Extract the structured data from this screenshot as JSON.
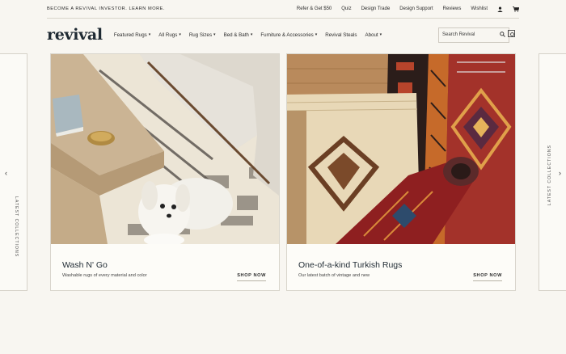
{
  "topbar": {
    "promo": "BECOME A REVIVAL INVESTOR. LEARN MORE.",
    "links": [
      "Refer & Get $50",
      "Quiz",
      "Design Trade",
      "Design Support",
      "Reviews",
      "Wishlist"
    ],
    "icons": [
      "user-icon",
      "cart-icon"
    ]
  },
  "nav": {
    "logo": "revival",
    "menu": [
      {
        "label": "Featured Rugs",
        "has_dropdown": true
      },
      {
        "label": "All Rugs",
        "has_dropdown": true
      },
      {
        "label": "Rug Sizes",
        "has_dropdown": true
      },
      {
        "label": "Bed & Bath",
        "has_dropdown": true
      },
      {
        "label": "Furniture & Accessories",
        "has_dropdown": true
      },
      {
        "label": "Revival Steals",
        "has_dropdown": false
      },
      {
        "label": "About",
        "has_dropdown": true
      }
    ],
    "search": {
      "placeholder": "Search Revival"
    }
  },
  "side_tabs": {
    "left_label": "LATEST COLLECTIONS",
    "right_label": "LATEST COLLECTIONS"
  },
  "collections": [
    {
      "title": "Wash N' Go",
      "description": "Washable rugs of every material and color",
      "cta": "SHOP NOW"
    },
    {
      "title": "One-of-a-kind Turkish Rugs",
      "description": "Our latest batch of vintage and new",
      "cta": "SHOP NOW"
    }
  ],
  "colors": {
    "background": "#f8f6f1",
    "text": "#2b2b2b",
    "logo": "#1f2a33"
  }
}
